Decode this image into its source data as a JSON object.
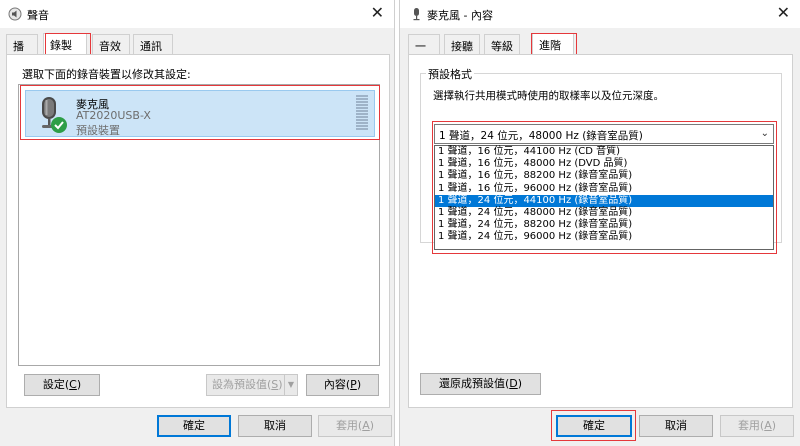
{
  "left_window": {
    "title": "聲音",
    "tabs": [
      "播放",
      "錄製",
      "音效",
      "通訊"
    ],
    "active_tab_index": 1,
    "instruction": "選取下面的錄音裝置以修改其設定:",
    "device": {
      "name": "麥克風",
      "model": "AT2020USB-X",
      "status": "預設裝置",
      "icon": "microphone-icon",
      "badge_icon": "check-badge-icon"
    },
    "buttons": {
      "configure": "設定(C)",
      "configure_text": "設定(",
      "configure_key": "C",
      "set_default_text": "設為預設值(",
      "set_default_key": "S",
      "properties_text": "內容(",
      "properties_key": "P"
    },
    "footer": {
      "ok": "確定",
      "cancel": "取消",
      "apply_text": "套用(",
      "apply_key": "A"
    }
  },
  "right_window": {
    "title": "麥克風 - 內容",
    "tabs": [
      "一般",
      "接聽",
      "等級",
      "進階"
    ],
    "active_tab_index": 3,
    "group_label": "預設格式",
    "group_description": "選擇執行共用模式時使用的取樣率以及位元深度。",
    "selected_value": "1 聲道，24 位元，48000 Hz (錄音室品質)",
    "options": [
      "1 聲道，16 位元，44100 Hz (CD 音質)",
      "1 聲道，16 位元，48000 Hz (DVD 品質)",
      "1 聲道，16 位元，88200 Hz (錄音室品質)",
      "1 聲道，16 位元，96000 Hz (錄音室品質)",
      "1 聲道，24 位元，44100 Hz (錄音室品質)",
      "1 聲道，24 位元，48000 Hz (錄音室品質)",
      "1 聲道，24 位元，88200 Hz (錄音室品質)",
      "1 聲道，24 位元，96000 Hz (錄音室品質)"
    ],
    "highlighted_option_index": 4,
    "restore_text": "還原成預設值(",
    "restore_key": "D",
    "footer": {
      "ok": "確定",
      "cancel": "取消",
      "apply_text": "套用(",
      "apply_key": "A"
    }
  },
  "colors": {
    "highlight_box": "#e5383b",
    "selection_blue": "#0078d7",
    "device_selected_bg": "#cce4f7",
    "check_badge": "#2e9e47"
  }
}
